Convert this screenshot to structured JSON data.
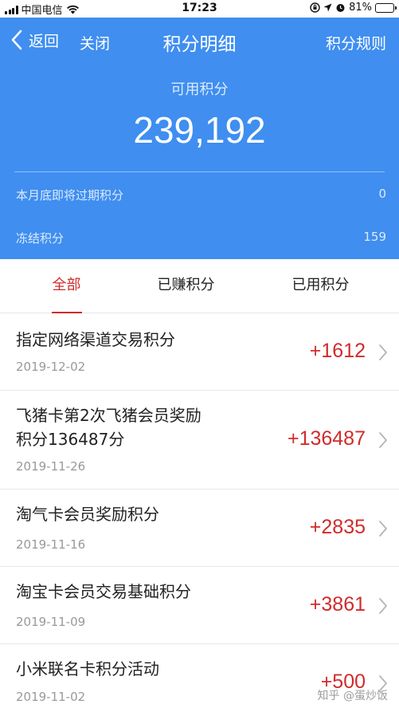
{
  "status_bar": {
    "carrier": "中国电信",
    "time": "17:23",
    "battery_percent": "81%",
    "battery_level": 0.81,
    "icons": [
      "signal-icon",
      "wifi-icon",
      "lock-rotation-icon",
      "location-icon",
      "alarm-icon",
      "battery-icon"
    ]
  },
  "nav": {
    "back_label": "返回",
    "close_label": "关闭",
    "title": "积分明细",
    "rules_label": "积分规则"
  },
  "summary": {
    "available_label": "可用积分",
    "available_value": "239,192",
    "expiring_label": "本月底即将过期积分",
    "expiring_value": "0",
    "frozen_label": "冻结积分",
    "frozen_value": "159"
  },
  "tabs": [
    {
      "label": "全部",
      "active": true
    },
    {
      "label": "已赚积分",
      "active": false
    },
    {
      "label": "已用积分",
      "active": false
    }
  ],
  "records": [
    {
      "title": "指定网络渠道交易积分",
      "date": "2019-12-02",
      "amount": "+1612"
    },
    {
      "title": "飞猪卡第2次飞猪会员奖励积分136487分",
      "title_lines": [
        "飞猪卡第2次飞猪会员奖励",
        "积分136487分"
      ],
      "date": "2019-11-26",
      "amount": "+136487"
    },
    {
      "title": "淘气卡会员奖励积分",
      "date": "2019-11-16",
      "amount": "+2835"
    },
    {
      "title": "淘宝卡会员交易基础积分",
      "date": "2019-11-09",
      "amount": "+3861"
    },
    {
      "title": "小米联名卡积分活动",
      "date": "2019-11-02",
      "amount": "+500"
    }
  ],
  "watermark": "知乎 @蛋炒饭",
  "colors": {
    "header_blue": "#3f8ef0",
    "accent_red": "#d12b2b"
  }
}
